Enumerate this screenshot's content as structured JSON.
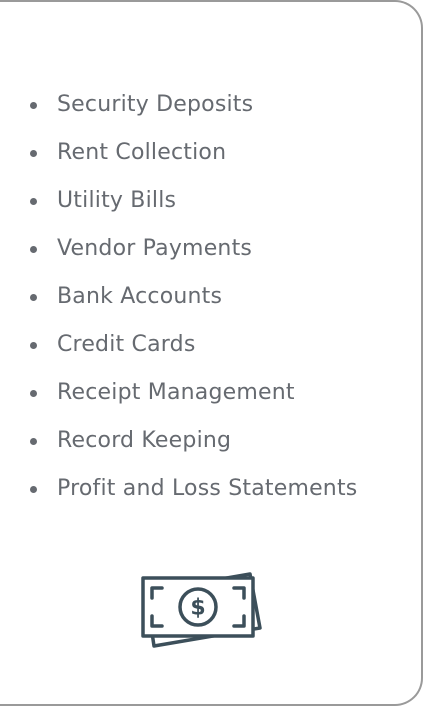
{
  "services": {
    "items": [
      {
        "label": "Security Deposits"
      },
      {
        "label": "Rent Collection"
      },
      {
        "label": "Utility Bills"
      },
      {
        "label": "Vendor Payments"
      },
      {
        "label": "Bank Accounts"
      },
      {
        "label": "Credit Cards"
      },
      {
        "label": "Receipt Management"
      },
      {
        "label": "Record Keeping"
      },
      {
        "label": "Profit and Loss Statements"
      }
    ]
  },
  "icon": {
    "name": "money-bill-icon",
    "symbol": "$",
    "color": "#3c4f5a"
  },
  "colors": {
    "text": "#666a70",
    "border": "#9a9a9a"
  }
}
